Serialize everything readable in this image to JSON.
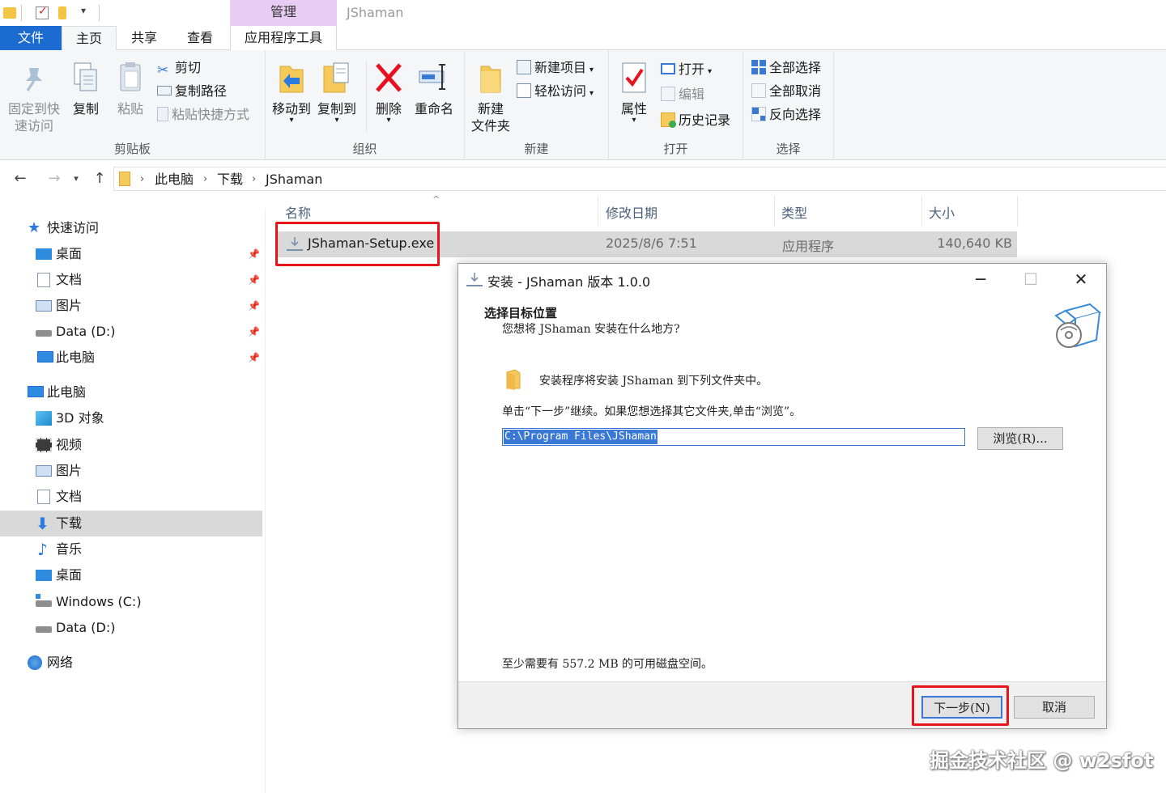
{
  "window": {
    "title": "JShaman",
    "context_tab": "管理"
  },
  "tabs": [
    {
      "label": "文件"
    },
    {
      "label": "主页"
    },
    {
      "label": "共享"
    },
    {
      "label": "查看"
    },
    {
      "label": "应用程序工具"
    }
  ],
  "ribbon": {
    "clipboard": {
      "group_label": "剪贴板",
      "pin_quick_line1": "固定到快",
      "pin_quick_line2": "速访问",
      "copy": "复制",
      "paste": "粘贴",
      "cut": "剪切",
      "copy_path": "复制路径",
      "paste_shortcut": "粘贴快捷方式"
    },
    "organize": {
      "group_label": "组织",
      "move_to": "移动到",
      "copy_to": "复制到",
      "delete": "删除",
      "rename": "重命名"
    },
    "new": {
      "group_label": "新建",
      "new_folder_line1": "新建",
      "new_folder_line2": "文件夹",
      "new_item": "新建项目",
      "easy_access": "轻松访问"
    },
    "open": {
      "group_label": "打开",
      "properties": "属性",
      "open": "打开",
      "edit": "编辑",
      "history": "历史记录"
    },
    "select": {
      "group_label": "选择",
      "select_all": "全部选择",
      "select_none": "全部取消",
      "invert": "反向选择"
    }
  },
  "address": {
    "crumbs": [
      "此电脑",
      "下载",
      "JShaman"
    ]
  },
  "nav": {
    "quick_access": "快速访问",
    "quick_items": [
      "桌面",
      "文档",
      "图片",
      "Data (D:)",
      "此电脑"
    ],
    "this_pc": "此电脑",
    "pc_items": [
      "3D 对象",
      "视频",
      "图片",
      "文档",
      "下载",
      "音乐",
      "桌面",
      "Windows (C:)",
      "Data (D:)"
    ],
    "network": "网络"
  },
  "filelist": {
    "columns": [
      "名称",
      "修改日期",
      "类型",
      "大小"
    ],
    "rows": [
      {
        "name": "JShaman-Setup.exe",
        "date": "2025/8/6 7:51",
        "type": "应用程序",
        "size": "140,640 KB"
      }
    ]
  },
  "dialog": {
    "title": "安装 - JShaman 版本 1.0.0",
    "heading": "选择目标位置",
    "subheading": "您想将 JShaman 安装在什么地方?",
    "info": "安装程序将安装 JShaman 到下列文件夹中。",
    "instruction": "单击“下一步”继续。如果您想选择其它文件夹,单击“浏览”。",
    "path_value": "C:\\Program Files\\JShaman",
    "browse": "浏览(R)...",
    "space_note": "至少需要有 557.2 MB 的可用磁盘空间。",
    "next": "下一步(N)",
    "cancel": "取消"
  },
  "watermark": "掘金技术社区 @ w2sfot",
  "colors": {
    "accent": "#1c6bd1",
    "highlight_red": "#e8141c",
    "context_purple": "#e8ccf3",
    "selection_blue": "#3a78d6"
  }
}
